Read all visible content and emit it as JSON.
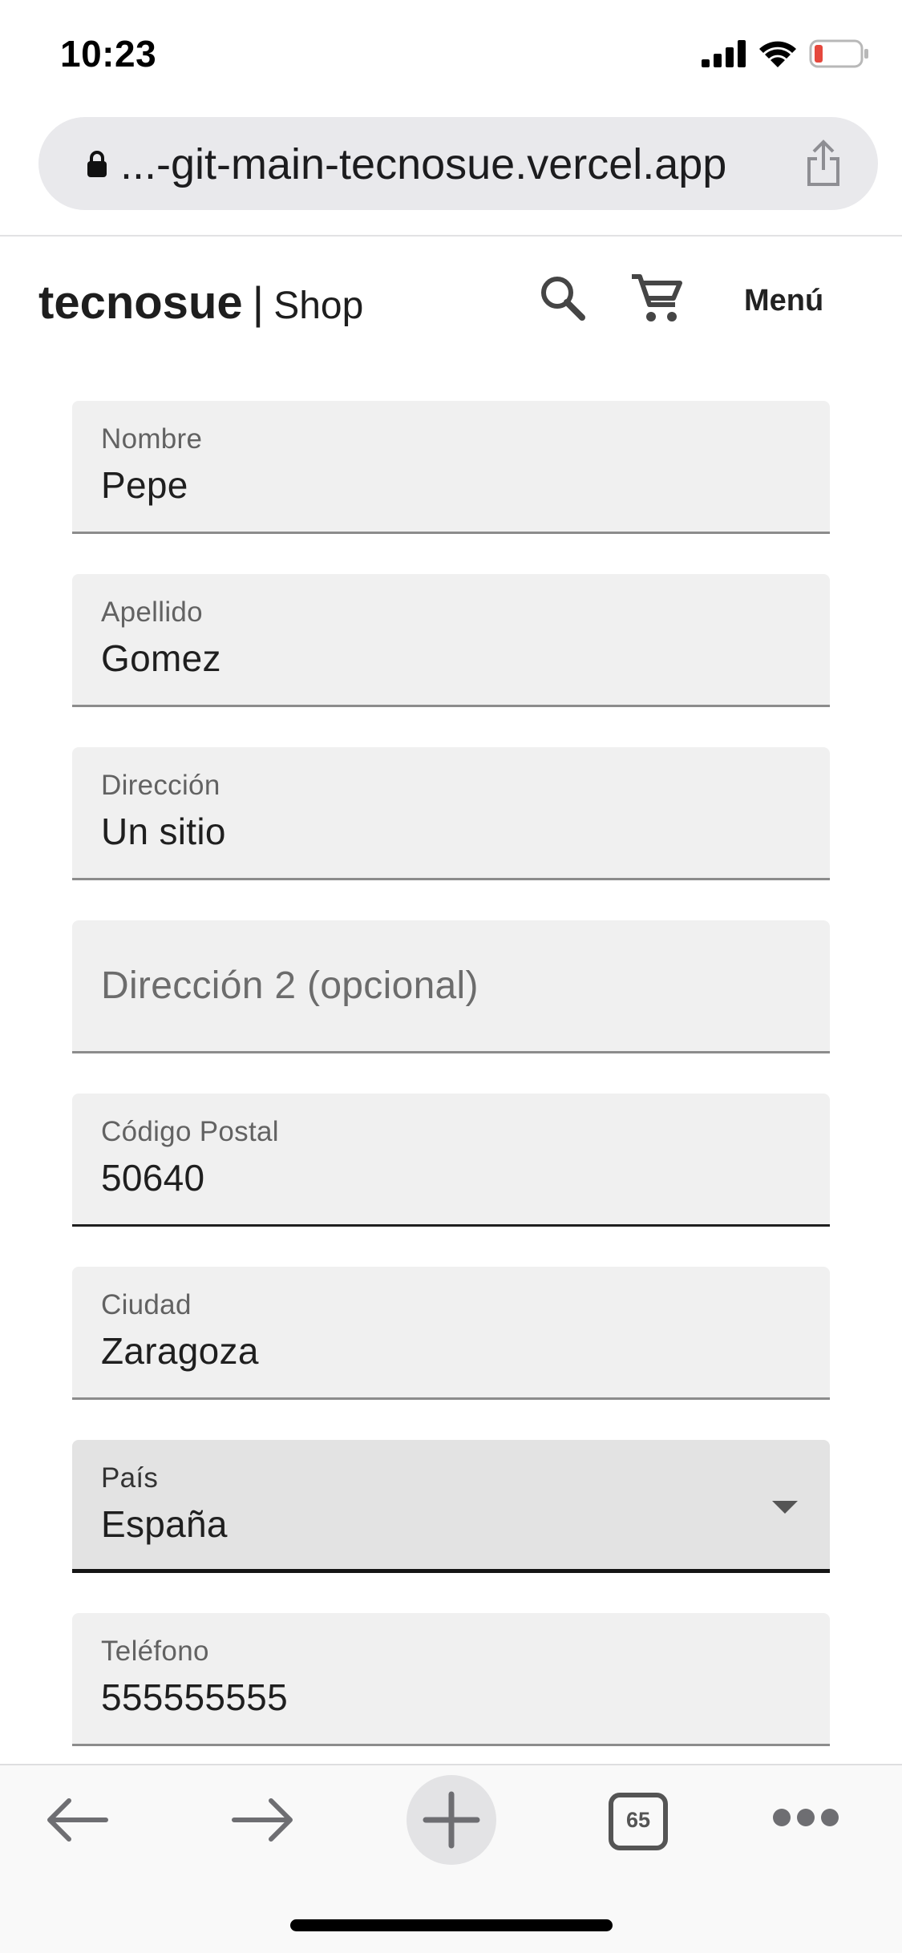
{
  "status_bar": {
    "time": "10:23",
    "icons": [
      "signal-icon",
      "wifi-icon",
      "battery-icon"
    ],
    "battery_color": "#e5483d"
  },
  "browser": {
    "url": "...-git-main-tecnosue.vercel.app",
    "icons": [
      "lock-icon",
      "share-icon"
    ]
  },
  "header": {
    "brand": "tecnosue",
    "separator": "|",
    "section": "Shop",
    "menu_label": "Menú",
    "icons": [
      "search-icon",
      "cart-icon"
    ]
  },
  "form": {
    "fields": [
      {
        "label": "Nombre",
        "value": "Pepe"
      },
      {
        "label": "Apellido",
        "value": "Gomez"
      },
      {
        "label": "Dirección",
        "value": "Un sitio"
      },
      {
        "label": "",
        "value": "",
        "placeholder": "Dirección 2 (opcional)"
      },
      {
        "label": "Código Postal",
        "value": "50640"
      },
      {
        "label": "Ciudad",
        "value": "Zaragoza"
      },
      {
        "label": "País",
        "value": "España"
      },
      {
        "label": "Teléfono",
        "value": "555555555"
      }
    ]
  },
  "toolbar": {
    "tab_count": "65",
    "icons": [
      "back-arrow-icon",
      "forward-arrow-icon",
      "plus-icon",
      "tabs-icon",
      "more-icon"
    ]
  }
}
